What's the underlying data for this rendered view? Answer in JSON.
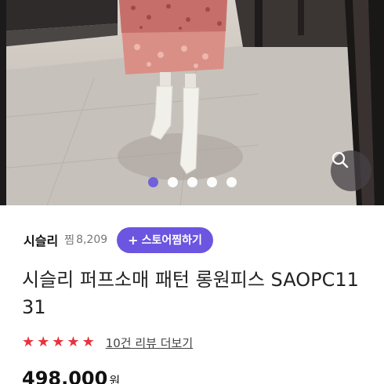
{
  "gallery": {
    "slide_count": 5,
    "active_index": 0,
    "accent_color": "#6a5cd8",
    "zoom_icon": "search-icon"
  },
  "store": {
    "name": "시슬리",
    "fav_label": "찜",
    "fav_count": "8,209",
    "fav_button_label": "스토어찜하기",
    "fav_button_color": "#6c55e0"
  },
  "product": {
    "title": "시슬리 퍼프소매 패턴 롱원피스 SAOPC1131",
    "rating": 5,
    "review_link": "10건 리뷰 더보기",
    "price": "498,000",
    "currency": "원",
    "star_color": "#e8333b"
  }
}
